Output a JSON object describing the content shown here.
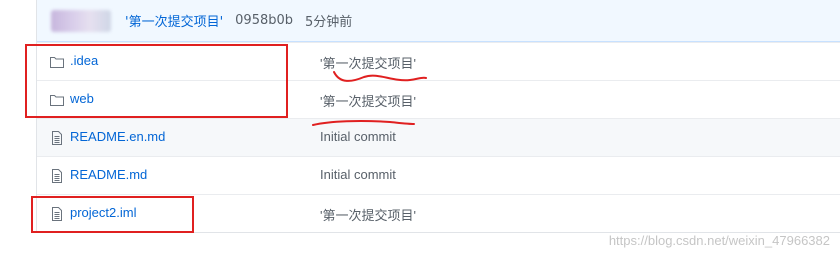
{
  "colors": {
    "link": "#0366d6",
    "muted": "#586069",
    "annotation": "#e02020"
  },
  "commit": {
    "message": "'第一次提交项目'",
    "sha": "0958b0b",
    "time": "5分钟前"
  },
  "files": [
    {
      "type": "folder",
      "icon": "folder-icon",
      "name": ".idea",
      "message": "'第一次提交项目'"
    },
    {
      "type": "folder",
      "icon": "folder-icon",
      "name": "web",
      "message": "'第一次提交项目'"
    },
    {
      "type": "file",
      "icon": "file-icon",
      "name": "README.en.md",
      "message": "Initial commit"
    },
    {
      "type": "file",
      "icon": "file-icon",
      "name": "README.md",
      "message": "Initial commit"
    },
    {
      "type": "file",
      "icon": "file-icon",
      "name": "project2.iml",
      "message": "'第一次提交项目'"
    }
  ],
  "watermark": "https://blog.csdn.net/weixin_47966382"
}
